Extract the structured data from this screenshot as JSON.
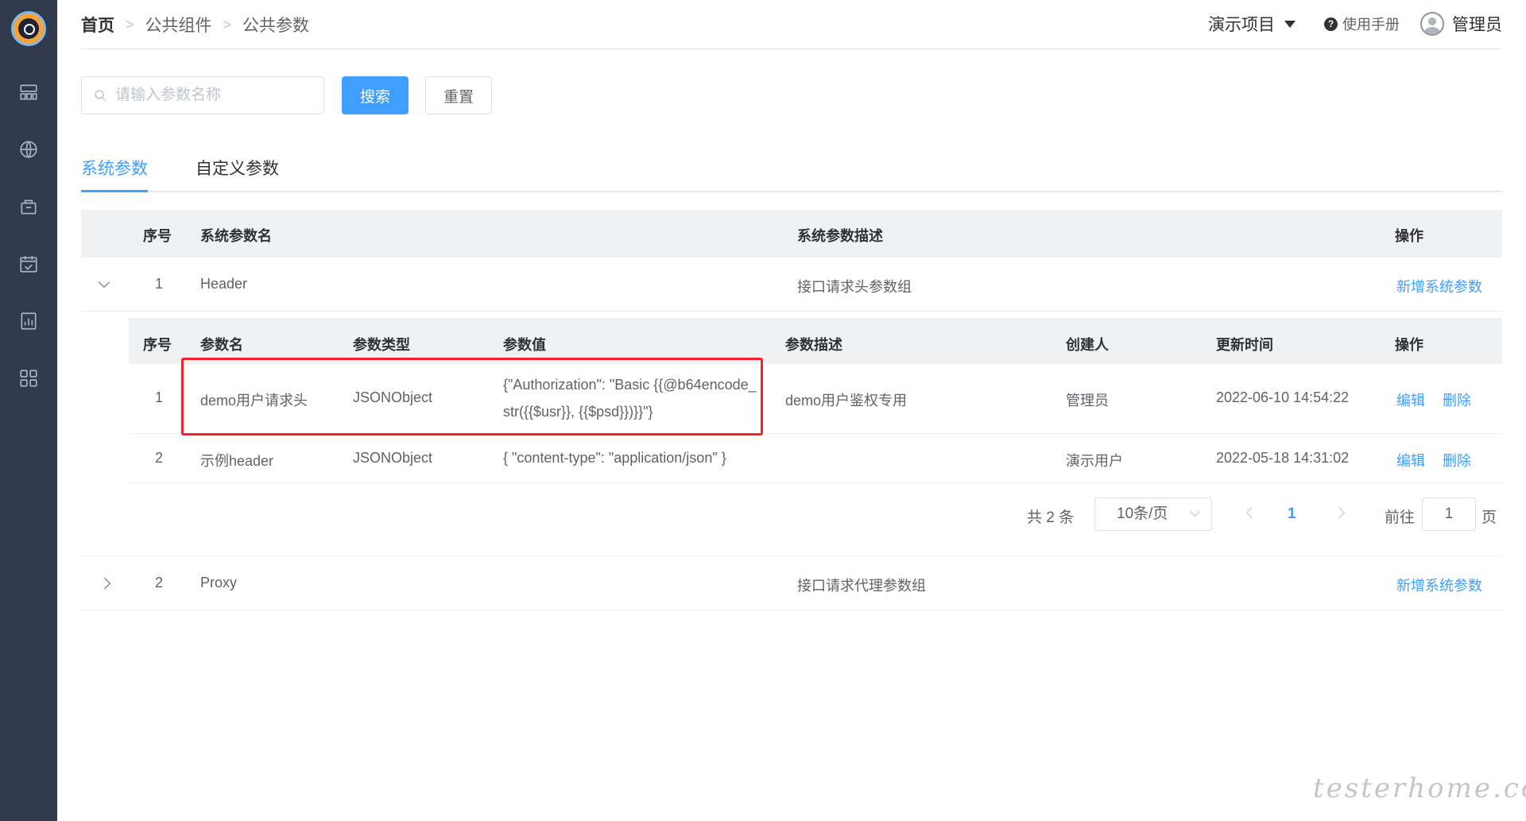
{
  "header": {
    "breadcrumb": [
      "首页",
      "公共组件",
      "公共参数"
    ],
    "project": "演示项目",
    "manual": "使用手册",
    "user": "管理员"
  },
  "search": {
    "placeholder": "请输入参数名称",
    "search_label": "搜索",
    "reset_label": "重置"
  },
  "tabs": [
    {
      "label": "系统参数",
      "active": true
    },
    {
      "label": "自定义参数",
      "active": false
    }
  ],
  "outer_table": {
    "headers": {
      "index": "序号",
      "name": "系统参数名",
      "desc": "系统参数描述",
      "action": "操作"
    },
    "rows": [
      {
        "index": "1",
        "name": "Header",
        "desc": "接口请求头参数组",
        "action": "新增系统参数",
        "expanded": true
      },
      {
        "index": "2",
        "name": "Proxy",
        "desc": "接口请求代理参数组",
        "action": "新增系统参数",
        "expanded": false
      }
    ]
  },
  "inner_table": {
    "headers": {
      "index": "序号",
      "name": "参数名",
      "type": "参数类型",
      "value": "参数值",
      "desc": "参数描述",
      "creator": "创建人",
      "updated": "更新时间",
      "action": "操作"
    },
    "rows": [
      {
        "index": "1",
        "name": "demo用户请求头",
        "type": "JSONObject",
        "value_line1": "{\"Authorization\": \"Basic {{@b64encode_",
        "value_line2": "str({{$usr}}, {{$psd}})}}\"}",
        "desc": "demo用户鉴权专用",
        "creator": "管理员",
        "updated": "2022-06-10 14:54:22",
        "edit": "编辑",
        "delete": "删除"
      },
      {
        "index": "2",
        "name": "示例header",
        "type": "JSONObject",
        "value_line1": "{ \"content-type\": \"application/json\" }",
        "desc": "",
        "creator": "演示用户",
        "updated": "2022-05-18 14:31:02",
        "edit": "编辑",
        "delete": "删除"
      }
    ]
  },
  "pagination": {
    "total": "共 2 条",
    "page_size": "10条/页",
    "current": "1",
    "goto": "前往",
    "goto_value": "1",
    "page_suffix": "页"
  },
  "watermark": "testerhome.com",
  "colors": {
    "sidebar": "#2f3a4c",
    "accent": "#409eff",
    "highlight": "#f5222d"
  }
}
